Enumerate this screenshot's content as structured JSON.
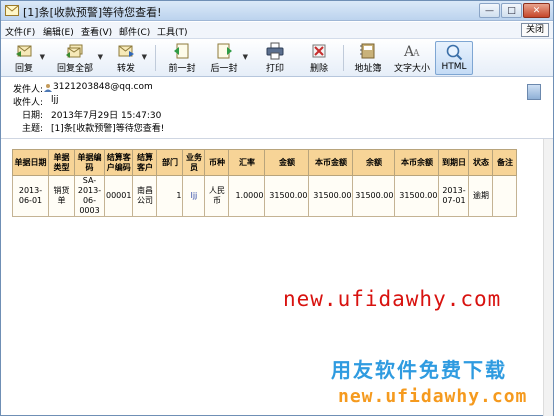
{
  "window": {
    "title": "[1]条[收款预警]等待您查看!",
    "close_label": "关闭"
  },
  "menu": [
    "文件(F)",
    "编辑(E)",
    "查看(V)",
    "邮件(C)",
    "工具(T)"
  ],
  "toolbar": [
    {
      "label": "回复",
      "icon": "reply-icon"
    },
    {
      "label": "回复全部",
      "icon": "reply-all-icon"
    },
    {
      "label": "转发",
      "icon": "forward-icon"
    },
    {
      "label": "前一封",
      "icon": "previous-mail-icon"
    },
    {
      "label": "后一封",
      "icon": "next-mail-icon"
    },
    {
      "label": "打印",
      "icon": "print-icon"
    },
    {
      "label": "删除",
      "icon": "delete-icon"
    },
    {
      "label": "地址簿",
      "icon": "address-book-icon"
    },
    {
      "label": "文字大小",
      "icon": "text-size-icon"
    },
    {
      "label": "HTML",
      "icon": "html-view-icon"
    }
  ],
  "mail": {
    "from_label": "发件人:",
    "from_value": "3121203848@qq.com",
    "to_label": "收件人:",
    "to_value": "ljj",
    "date_label": "日期:",
    "date_value": "2013年7月29日 15:47:30",
    "subject_label": "主题:",
    "subject_value": "[1]条[收款预警]等待您查看!"
  },
  "table": {
    "headers": [
      "单据日期",
      "单据类型",
      "单据编码",
      "结算客户编码",
      "结算客户",
      "部门",
      "业务员",
      "币种",
      "汇率",
      "金额",
      "本币金额",
      "余额",
      "本币余额",
      "到期日",
      "状态",
      "备注"
    ],
    "row": [
      "2013-06-01",
      "销货单",
      "SA-2013-06-0003",
      "00001",
      "南昌公司",
      "1",
      "ljj",
      "人民币",
      "1.0000",
      "31500.00",
      "31500.00",
      "31500.00",
      "31500.00",
      "2013-07-01",
      "逾期",
      ""
    ]
  },
  "watermark": {
    "url_red": "new.ufidawhy.com",
    "cn_text": "用友软件免费下载",
    "url_orange": "new.ufidawhy.com"
  }
}
